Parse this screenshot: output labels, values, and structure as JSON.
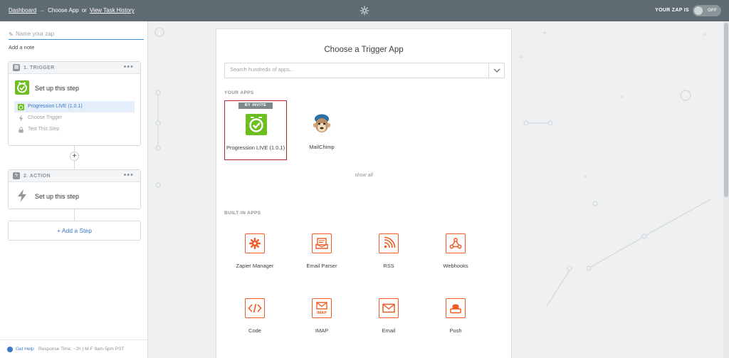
{
  "topbar": {
    "breadcrumb_dashboard": "Dashboard",
    "breadcrumb_separator": "→",
    "breadcrumb_current": "Choose App",
    "breadcrumb_or": "or",
    "breadcrumb_history": "View Task History",
    "status_label": "YOUR ZAP IS",
    "toggle_label": "OFF"
  },
  "sidebar": {
    "zap_name_placeholder": "Name your zap",
    "add_note": "Add a note",
    "trigger": {
      "header": "1. TRIGGER",
      "menu": "•••",
      "setup_label": "Set up this step",
      "substeps": [
        {
          "label": "Progression LIVE (1.0.1)",
          "active": true
        },
        {
          "label": "Choose Trigger",
          "active": false
        },
        {
          "label": "Test This Step",
          "active": false
        }
      ]
    },
    "action": {
      "header": "2. ACTION",
      "menu": "•••",
      "setup_label": "Set up this step"
    },
    "add_step": "+ Add a Step",
    "help": {
      "link": "Get Help",
      "info": "Response Time: ~2h | M-F 9am-5pm PST"
    }
  },
  "main": {
    "title": "Choose a Trigger App",
    "search_placeholder": "Search hundreds of apps...",
    "your_apps_label": "YOUR APPS",
    "your_apps": [
      {
        "name": "Progression LIVE (1.0.1)",
        "badge": "BY INVITE",
        "selected": true
      },
      {
        "name": "MailChimp",
        "badge": "",
        "selected": false
      }
    ],
    "show_all": "show all",
    "builtin_label": "BUILT-IN APPS",
    "builtin_apps": [
      {
        "name": "Zapier Manager",
        "icon": "gear-icon"
      },
      {
        "name": "Email Parser",
        "icon": "email-parser-icon"
      },
      {
        "name": "RSS",
        "icon": "rss-icon"
      },
      {
        "name": "Webhooks",
        "icon": "webhooks-icon"
      },
      {
        "name": "Code",
        "icon": "code-icon"
      },
      {
        "name": "IMAP",
        "icon": "imap-icon",
        "icon_text": "IMAP"
      },
      {
        "name": "Email",
        "icon": "envelope-icon"
      },
      {
        "name": "Push",
        "icon": "push-button-icon"
      }
    ]
  },
  "colors": {
    "topbar": "#5f6b72",
    "accent_blue": "#3d78c8",
    "builtin_orange": "#ef5a24",
    "progression_green": "#6cbf1e",
    "selected_border": "#b3252c"
  }
}
